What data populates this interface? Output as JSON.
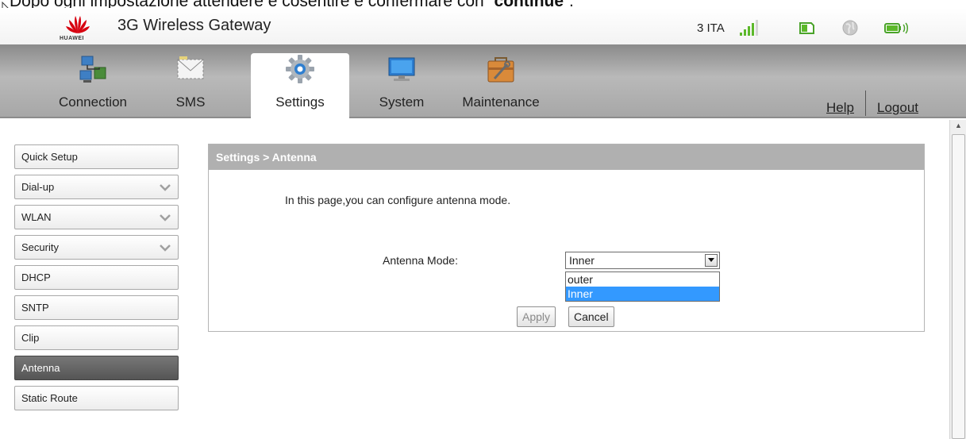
{
  "caption": {
    "prefix": "Dopo ogni impostazione attendere e cosentire e confermare con “",
    "bold": "continue",
    "suffix": "”."
  },
  "brand": {
    "logo_text": "HUAWEI",
    "app_title": "3G Wireless Gateway",
    "accent": "#d7000f"
  },
  "status": {
    "network": "3 ITA",
    "signal_level": 0.6,
    "icons": [
      "signal-icon",
      "sim-card-icon",
      "globe-icon",
      "battery-icon"
    ]
  },
  "nav": {
    "tabs": [
      {
        "label": "Connection",
        "icon": "connection-icon",
        "active": false
      },
      {
        "label": "SMS",
        "icon": "envelope-icon",
        "active": false
      },
      {
        "label": "Settings",
        "icon": "gear-icon",
        "active": true
      },
      {
        "label": "System",
        "icon": "monitor-icon",
        "active": false
      },
      {
        "label": "Maintenance",
        "icon": "toolbox-icon",
        "active": false
      }
    ],
    "help": "Help",
    "logout": "Logout"
  },
  "sidebar": {
    "items": [
      {
        "label": "Quick Setup",
        "expandable": false,
        "active": false
      },
      {
        "label": "Dial-up",
        "expandable": true,
        "active": false
      },
      {
        "label": "WLAN",
        "expandable": true,
        "active": false
      },
      {
        "label": "Security",
        "expandable": true,
        "active": false
      },
      {
        "label": "DHCP",
        "expandable": false,
        "active": false
      },
      {
        "label": "SNTP",
        "expandable": false,
        "active": false
      },
      {
        "label": "Clip",
        "expandable": false,
        "active": false
      },
      {
        "label": "Antenna",
        "expandable": false,
        "active": true
      },
      {
        "label": "Static Route",
        "expandable": false,
        "active": false
      }
    ]
  },
  "panel": {
    "breadcrumb": "Settings > Antenna",
    "intro": "In this page,you can configure antenna mode.",
    "antenna_mode_label": "Antenna Mode:",
    "antenna_mode_value": "Inner",
    "options": [
      "outer",
      "Inner"
    ],
    "apply": "Apply",
    "cancel": "Cancel"
  }
}
